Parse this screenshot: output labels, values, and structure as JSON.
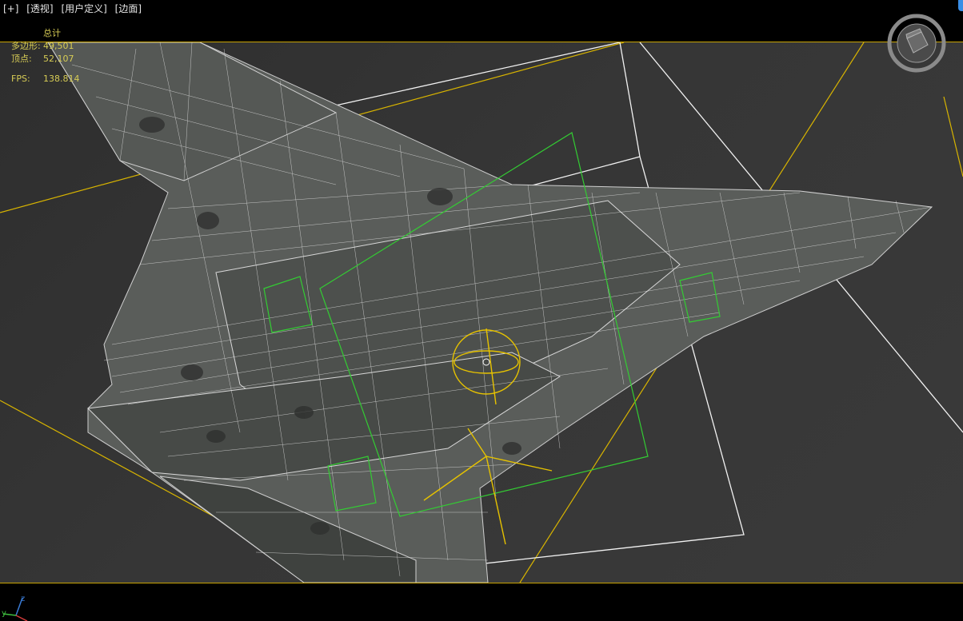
{
  "viewport": {
    "labels": [
      "[+]",
      "[透视]",
      "[用户定义]",
      "[边面]"
    ]
  },
  "stats": {
    "header": "总计",
    "polygons_label": "多边形:",
    "polygons_value": "49,501",
    "vertices_label": "顶点:",
    "vertices_value": "52,107",
    "fps_label": "FPS:",
    "fps_value": "138.814"
  },
  "navcube": {
    "icon": "view-cube-icon"
  },
  "axis": {
    "z": "z",
    "y": "y"
  },
  "colors": {
    "background": "#000000",
    "viewport_bg": "#343434",
    "wire": "#e8e8e8",
    "selection": "#33cc33",
    "gizmo": "#e6c200",
    "stats_text": "#d7cc55"
  }
}
